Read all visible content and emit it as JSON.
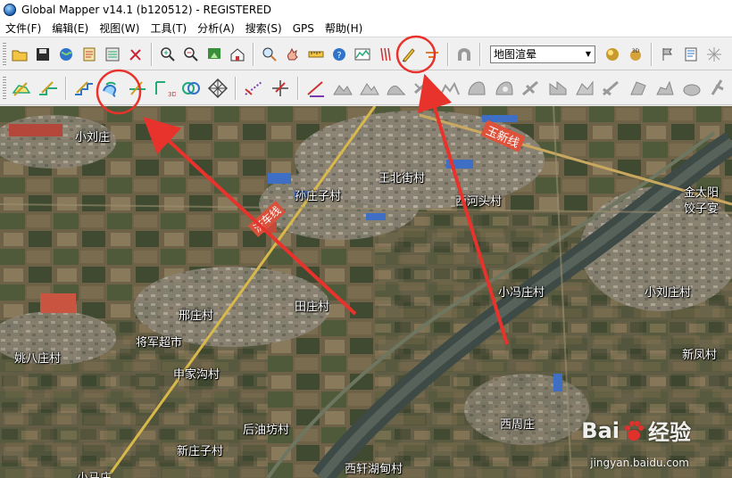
{
  "window": {
    "title": "Global Mapper v14.1 (b120512) - REGISTERED"
  },
  "menu": [
    {
      "label": "文件(F)"
    },
    {
      "label": "编辑(E)"
    },
    {
      "label": "视图(W)"
    },
    {
      "label": "工具(T)"
    },
    {
      "label": "分析(A)"
    },
    {
      "label": "搜索(S)"
    },
    {
      "label": "GPS"
    },
    {
      "label": "帮助(H)"
    }
  ],
  "toolbar1": {
    "dropdown_value": "地图渲晕",
    "icons": [
      "open-icon",
      "save-icon",
      "globe-icon",
      "layers-icon",
      "overlay-control-icon",
      "config-icon",
      "zoom-in-icon",
      "zoom-out-icon",
      "zoom-extent-icon",
      "home-icon",
      "magnify-icon",
      "pan-icon",
      "measure-icon",
      "info-icon",
      "path-profile-icon",
      "view-shed-icon",
      "digitizer-icon",
      "line-style-icon",
      "tunnel-icon",
      "shader-icon",
      "3d-view-icon",
      "script-icon",
      "flag-icon",
      "zoom-full-icon"
    ]
  },
  "toolbar2": {
    "icons": [
      "create-area-icon",
      "create-line-icon",
      "edit-vertex-icon",
      "auto-trace-icon",
      "snap-icon",
      "coordinate-icon",
      "buffer-icon",
      "grid-icon",
      "split-icon",
      "join-icon",
      "add-point-icon",
      "feature-info-icon",
      "terrain-a-icon",
      "terrain-b-icon",
      "terrain-c-icon",
      "terrain-d-icon",
      "terrain-e-icon",
      "terrain-f-icon",
      "terrain-g-icon",
      "terrain-h-icon",
      "terrain-i-icon",
      "terrain-j-icon",
      "terrain-k-icon",
      "terrain-l-icon",
      "terrain-m-icon"
    ]
  },
  "map": {
    "labels": [
      "小刘庄",
      "王北街村",
      "孙庄子村",
      "西河头村",
      "田庄村",
      "邢庄村",
      "将军超市",
      "姚八庄村",
      "申家沟村",
      "后油坊村",
      "新庄子村",
      "小马庄",
      "西轩湖甸村",
      "西周庄",
      "小冯庄村",
      "小刘庄村",
      "新凤村",
      "金太阳",
      "饺子宴",
      "玉新线",
      "济车线"
    ]
  },
  "watermark": {
    "brand_left": "Bai",
    "brand_right": "经验",
    "url": "jingyan.baidu.com"
  },
  "colors": {
    "annotation": "#e8322c",
    "title_bg": "#ffffff",
    "toolbar_bg": "#f0f0f0"
  }
}
